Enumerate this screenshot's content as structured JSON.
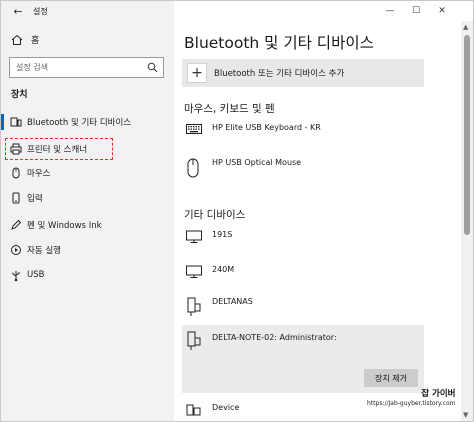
{
  "window": {
    "title": "설정",
    "controls": {
      "minimize": "—",
      "maximize": "☐",
      "close": "✕"
    }
  },
  "sidebar": {
    "home_label": "홈",
    "search_placeholder": "설정 검색",
    "section_title": "장치",
    "items": [
      {
        "label": "Bluetooth 및 기타 디바이스",
        "icon": "bluetooth-device-icon",
        "active": true
      },
      {
        "label": "프린터 및 스캐너",
        "icon": "printer-icon",
        "active": false
      },
      {
        "label": "마우스",
        "icon": "mouse-icon",
        "active": false
      },
      {
        "label": "입력",
        "icon": "keyboard-icon",
        "active": false
      },
      {
        "label": "펜 및 Windows Ink",
        "icon": "pen-icon",
        "active": false
      },
      {
        "label": "자동 실행",
        "icon": "autoplay-icon",
        "active": false
      },
      {
        "label": "USB",
        "icon": "usb-icon",
        "active": false
      }
    ]
  },
  "main": {
    "title": "Bluetooth 및 기타 디바이스",
    "add_device_label": "Bluetooth 또는 기타 디바이스 추가",
    "groups": [
      {
        "title": "마우스, 키보드 및 펜",
        "devices": [
          {
            "name": "HP Elite USB Keyboard - KR",
            "icon": "keyboard-icon"
          },
          {
            "name": "HP USB Optical Mouse",
            "icon": "mouse-icon"
          }
        ]
      },
      {
        "title": "기타 디바이스",
        "devices": [
          {
            "name": "191S",
            "icon": "monitor-icon"
          },
          {
            "name": "240M",
            "icon": "monitor-icon"
          },
          {
            "name": "DELTANAS",
            "icon": "network-device-icon"
          },
          {
            "name": "DELTA-NOTE-02: Administrator:",
            "icon": "network-device-icon",
            "selected": true
          },
          {
            "name": "Device",
            "icon": "generic-device-icon"
          }
        ]
      }
    ],
    "remove_button_label": "장치 제거"
  },
  "watermark": {
    "title": "잡 가이버",
    "url": "https://Jab-guyber.tistory.com"
  }
}
